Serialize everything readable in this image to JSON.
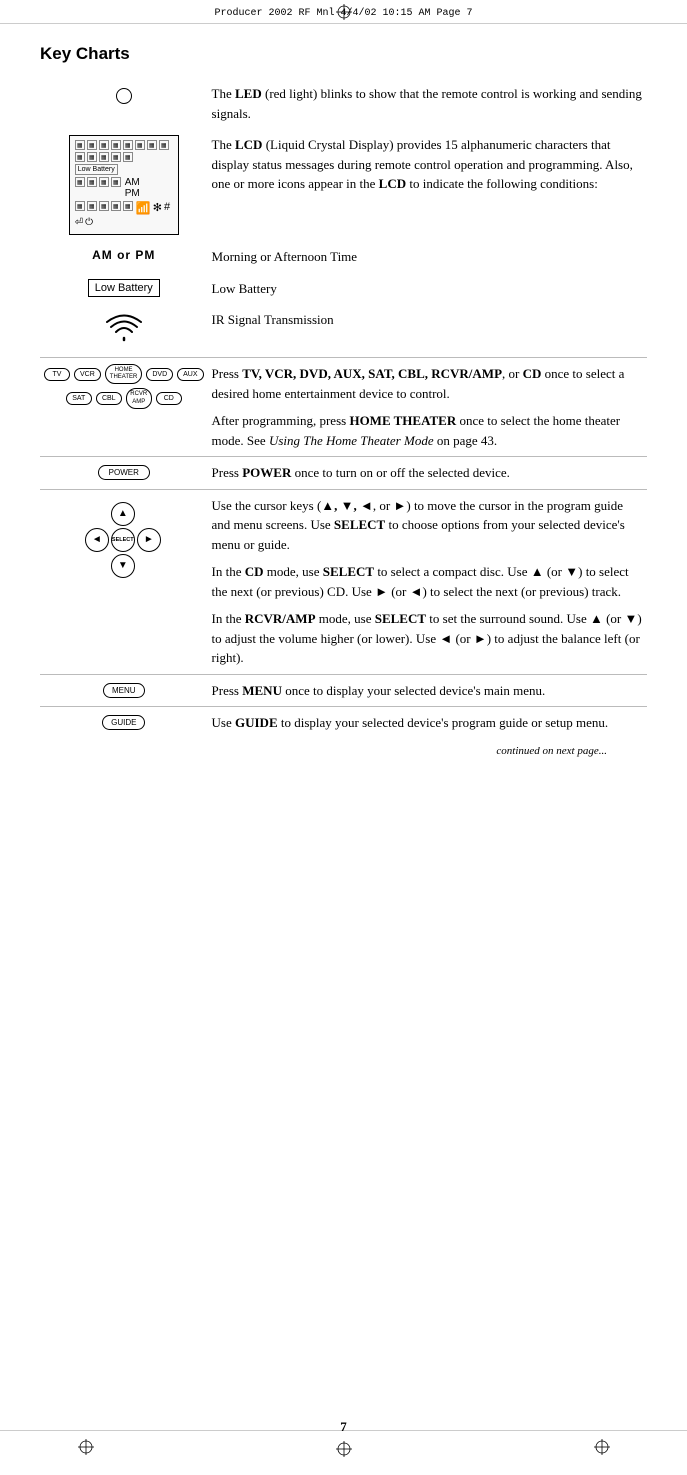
{
  "header": {
    "text": "Producer 2002 RF Mnl   4/4/02   10:15 AM   Page 7"
  },
  "page_title": "Key Charts",
  "rows": [
    {
      "id": "led",
      "icon_type": "led_circle",
      "description": [
        {
          "text": "The ",
          "bold": false
        },
        {
          "text": "LED",
          "bold": true
        },
        {
          "text": " (red light) blinks to show that the remote control is working and sending signals.",
          "bold": false
        }
      ]
    },
    {
      "id": "lcd",
      "icon_type": "lcd_display",
      "description": [
        {
          "text": "The ",
          "bold": false
        },
        {
          "text": "LCD",
          "bold": true
        },
        {
          "text": " (Liquid Crystal Display) provides 15 alphanumeric characters that display status messages during remote control operation and programming. Also, one or more icons appear in the ",
          "bold": false
        },
        {
          "text": "LCD",
          "bold": true
        },
        {
          "text": " to indicate the following conditions:",
          "bold": false
        }
      ]
    },
    {
      "id": "ampm",
      "icon_type": "ampm",
      "description": "Morning or Afternoon Time"
    },
    {
      "id": "lowbattery",
      "icon_type": "low_battery",
      "description": "Low Battery"
    },
    {
      "id": "ir",
      "icon_type": "wifi",
      "description": "IR Signal Transmission"
    },
    {
      "id": "devices",
      "icon_type": "device_buttons",
      "has_border": true,
      "description_parts": [
        {
          "text_segments": [
            {
              "text": "Press ",
              "bold": false
            },
            {
              "text": "TV, VCR, DVD, AUX, SAT, CBL, RCVR/AMP",
              "bold": true
            },
            {
              "text": ", or ",
              "bold": false
            },
            {
              "text": "CD",
              "bold": true
            },
            {
              "text": " once to select a desired home entertainment device to control.",
              "bold": false
            }
          ]
        },
        {
          "text_segments": [
            {
              "text": "After programming, press ",
              "bold": false
            },
            {
              "text": "HOME THEATER",
              "bold": true
            },
            {
              "text": " once to select the home theater mode. See ",
              "bold": false
            },
            {
              "text": "Using The Home Theater Mode",
              "bold": false,
              "italic": true
            },
            {
              "text": " on page 43.",
              "bold": false
            }
          ]
        }
      ]
    },
    {
      "id": "power",
      "icon_type": "power_button",
      "has_border": true,
      "description": [
        {
          "text": "Press ",
          "bold": false
        },
        {
          "text": "POWER",
          "bold": true
        },
        {
          "text": " once to turn on or off the selected device.",
          "bold": false
        }
      ]
    },
    {
      "id": "cursor",
      "icon_type": "cursor_cluster",
      "has_border": true,
      "description_parts": [
        {
          "text_segments": [
            {
              "text": "Use the cursor keys (",
              "bold": false
            },
            {
              "text": "▲, ▼, ◄",
              "bold": false
            },
            {
              "text": ", or ",
              "bold": false
            },
            {
              "text": "►",
              "bold": false
            },
            {
              "text": ") to move the cursor in the program guide and menu screens. Use ",
              "bold": false
            },
            {
              "text": "SELECT",
              "bold": true
            },
            {
              "text": " to choose options from your selected device's menu or guide.",
              "bold": false
            }
          ]
        },
        {
          "text_segments": [
            {
              "text": "In the ",
              "bold": false
            },
            {
              "text": "CD",
              "bold": true
            },
            {
              "text": " mode, use ",
              "bold": false
            },
            {
              "text": "SELECT",
              "bold": true
            },
            {
              "text": " to select a compact disc. Use ▲ (or ▼) to select the next (or previous) CD. Use  ► (or ◄) to select the next (or previous) track.",
              "bold": false
            }
          ]
        },
        {
          "text_segments": [
            {
              "text": "In the ",
              "bold": false
            },
            {
              "text": "RCVR/AMP",
              "bold": true
            },
            {
              "text": " mode, use ",
              "bold": false
            },
            {
              "text": "SELECT",
              "bold": true
            },
            {
              "text": " to set the surround sound. Use ▲ (or ▼) to adjust the volume higher (or lower). Use ◄ (or ►) to adjust the balance left (or right).",
              "bold": false
            }
          ]
        }
      ]
    },
    {
      "id": "menu",
      "icon_type": "menu_button",
      "has_border": true,
      "description": [
        {
          "text": "Press ",
          "bold": false
        },
        {
          "text": "MENU",
          "bold": true
        },
        {
          "text": " once to display your selected device's main menu.",
          "bold": false
        }
      ]
    },
    {
      "id": "guide",
      "icon_type": "guide_button",
      "has_border": true,
      "description": [
        {
          "text": "Use ",
          "bold": false
        },
        {
          "text": "GUIDE",
          "bold": true
        },
        {
          "text": " to display your selected device's program guide or setup menu.",
          "bold": false
        }
      ]
    }
  ],
  "continued_text": "continued on next page...",
  "page_number": "7",
  "buttons": {
    "tv": "TV",
    "vcr": "VCR",
    "home_theater": "HOME\nTHEATER",
    "dvd": "DVD",
    "aux": "AUX",
    "sat": "SAT",
    "cbl": "CBL",
    "rcvr_amp": "RCVR\nAMP",
    "cd": "CD",
    "power": "POWER",
    "select": "SELECT",
    "menu": "MENU",
    "guide": "GUIDE"
  },
  "ampm_text": "AM  or  PM",
  "low_battery_text": "Low Battery",
  "cursor_up": "▲",
  "cursor_left": "◄",
  "cursor_right": "►",
  "cursor_down": "▼"
}
